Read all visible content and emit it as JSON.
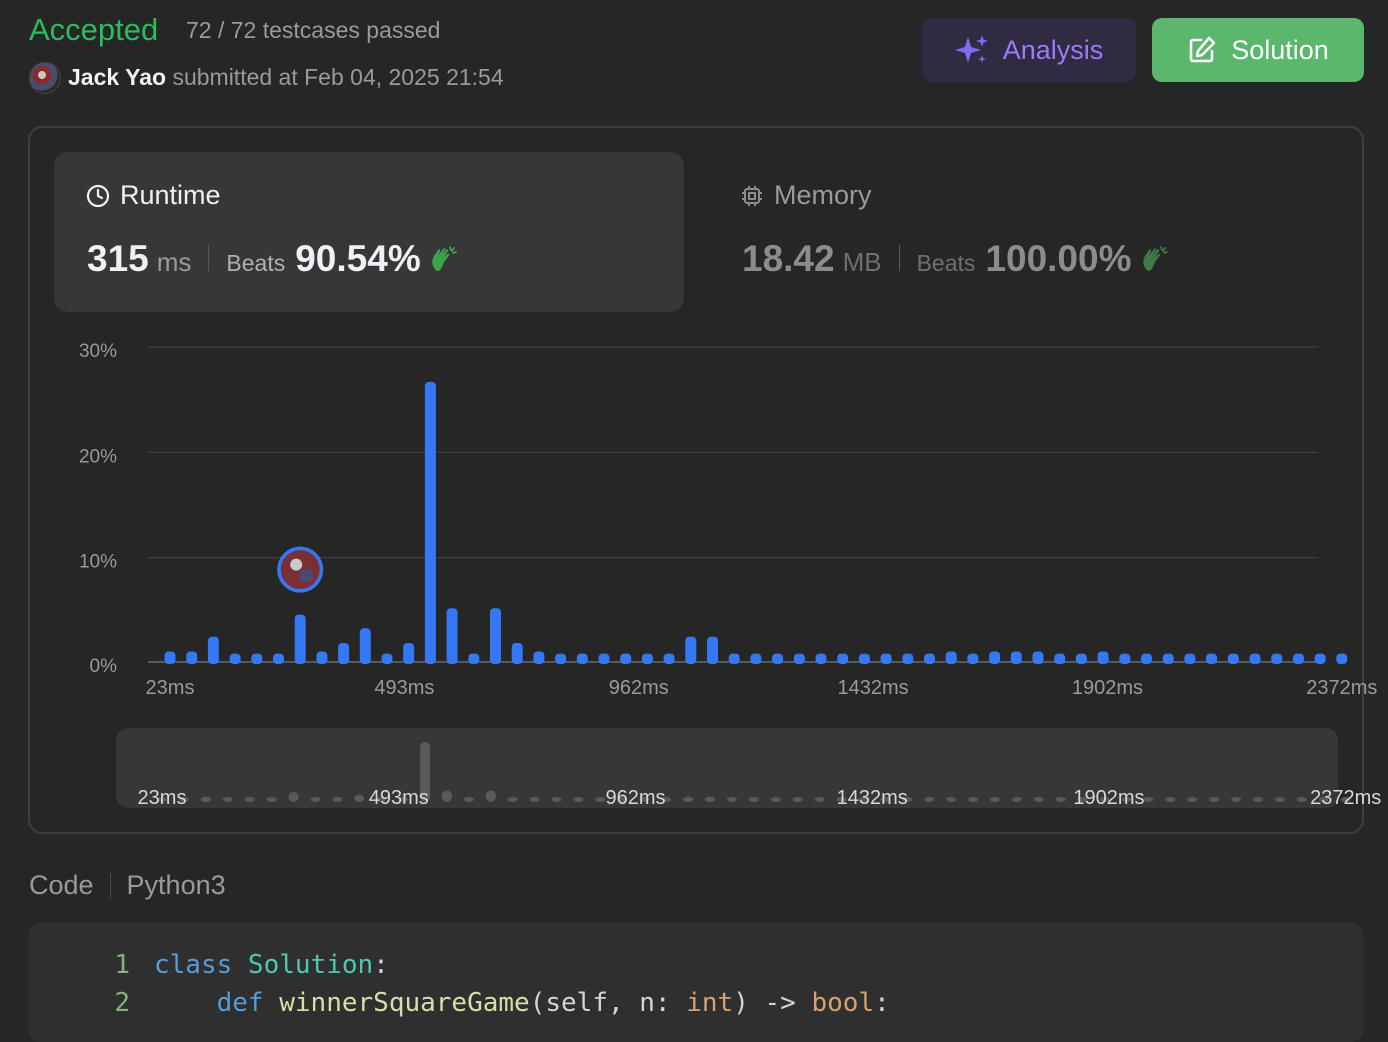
{
  "header": {
    "status": "Accepted",
    "testcases": "72 / 72 testcases passed",
    "submitter_name": "Jack Yao",
    "submitted_text": "submitted at Feb 04, 2025 21:54",
    "analysis_label": "Analysis",
    "solution_label": "Solution"
  },
  "runtime": {
    "title": "Runtime",
    "value": "315",
    "unit": "ms",
    "beats_label": "Beats",
    "beats_pct": "90.54%"
  },
  "memory": {
    "title": "Memory",
    "value": "18.42",
    "unit": "MB",
    "beats_label": "Beats",
    "beats_pct": "100.00%"
  },
  "chart_data": {
    "type": "bar",
    "y_tick_labels": [
      "0%",
      "10%",
      "20%",
      "30%"
    ],
    "ylim": [
      0,
      30
    ],
    "x_tick_labels": [
      "23ms",
      "493ms",
      "962ms",
      "1432ms",
      "1902ms",
      "2372ms"
    ],
    "values": [
      1.0,
      1.0,
      2.4,
      0.8,
      0.8,
      0.8,
      4.5,
      1.0,
      1.8,
      3.2,
      0.8,
      1.8,
      26.6,
      5.1,
      0.8,
      5.1,
      1.8,
      1.0,
      0.8,
      0.8,
      0.8,
      0.8,
      0.8,
      0.8,
      2.4,
      2.4,
      0.8,
      0.8,
      0.8,
      0.8,
      0.8,
      0.8,
      0.8,
      0.8,
      0.8,
      0.8,
      1.0,
      0.8,
      1.0,
      1.0,
      1.0,
      0.8,
      0.8,
      1.0,
      0.8,
      0.8,
      0.8,
      0.8,
      0.8,
      0.8,
      0.8,
      0.8,
      0.8,
      0.8,
      0.8
    ],
    "highlight_index": 6,
    "grid": true
  },
  "code": {
    "label": "Code",
    "language": "Python3",
    "lines": [
      {
        "num": "1",
        "tokens": [
          [
            "kw",
            "class "
          ],
          [
            "cls",
            "Solution"
          ],
          [
            "pl",
            ":"
          ]
        ]
      },
      {
        "num": "2",
        "tokens": [
          [
            "pl",
            "    "
          ],
          [
            "kw",
            "def "
          ],
          [
            "fn",
            "winnerSquareGame"
          ],
          [
            "pl",
            "(self, n: "
          ],
          [
            "ty",
            "int"
          ],
          [
            "pl",
            ") -> "
          ],
          [
            "ty",
            "bool"
          ],
          [
            "pl",
            ":"
          ]
        ]
      }
    ]
  },
  "colors": {
    "accepted": "#2cbb5d",
    "bar": "#3478f6",
    "analysis_text": "#9a7cf6",
    "solution_bg": "#5ab76b"
  }
}
